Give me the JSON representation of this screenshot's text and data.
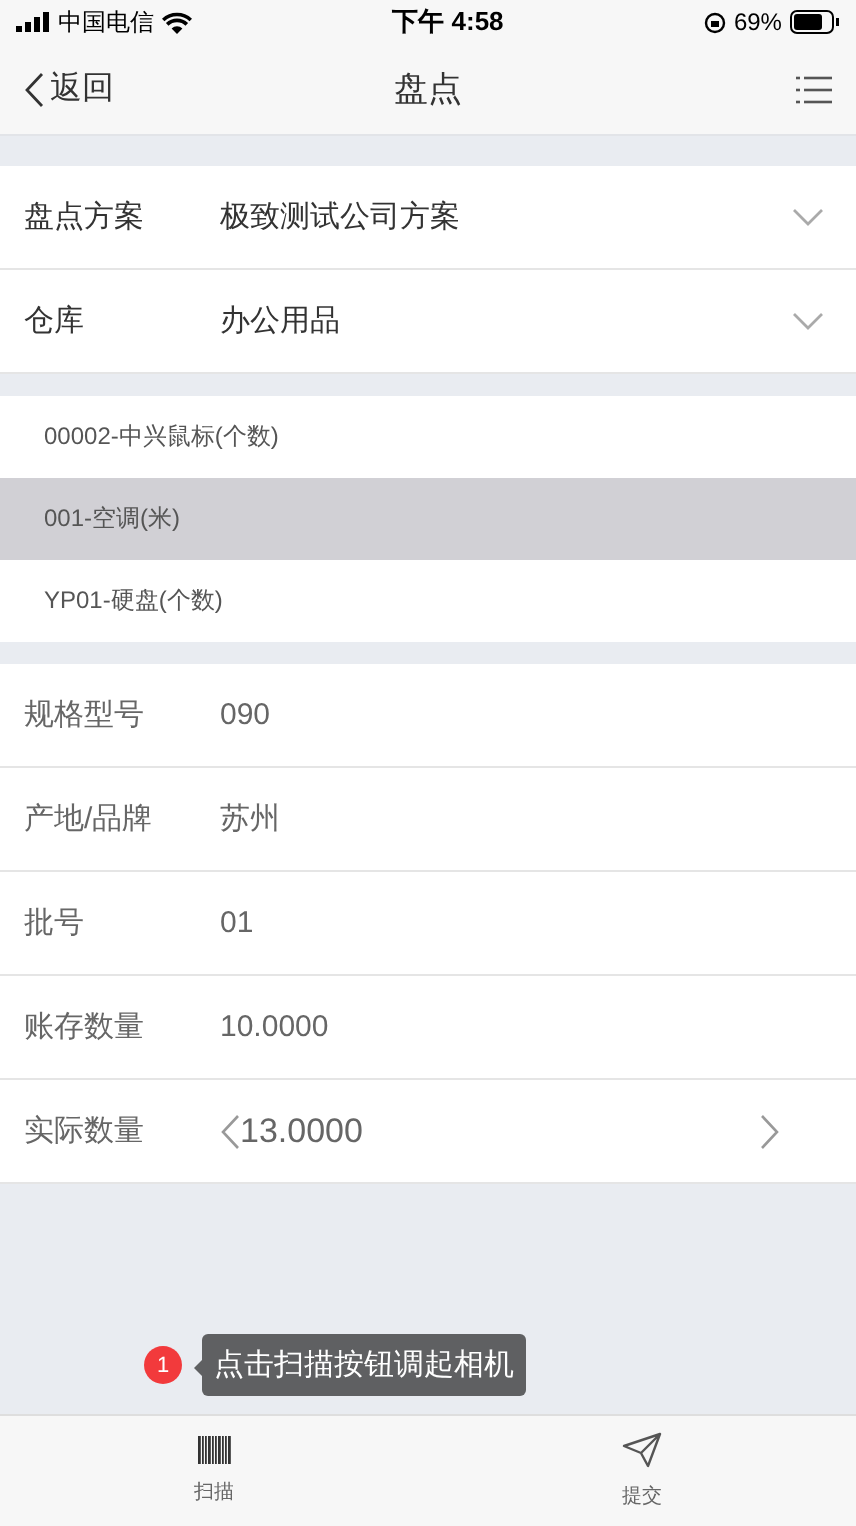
{
  "status_bar": {
    "carrier": "中国电信",
    "time": "下午 4:58",
    "battery": "69%"
  },
  "nav": {
    "back": "返回",
    "title": "盘点"
  },
  "selects": [
    {
      "label": "盘点方案",
      "value": "极致测试公司方案"
    },
    {
      "label": "仓库",
      "value": "办公用品"
    }
  ],
  "items": [
    {
      "text": "00002-中兴鼠标(个数)",
      "selected": false
    },
    {
      "text": "001-空调(米)",
      "selected": true
    },
    {
      "text": "YP01-硬盘(个数)",
      "selected": false
    }
  ],
  "details": [
    {
      "kind": "text",
      "label": "规格型号",
      "value": "090"
    },
    {
      "kind": "text",
      "label": "产地/品牌",
      "value": "苏州"
    },
    {
      "kind": "text",
      "label": "批号",
      "value": "01"
    },
    {
      "kind": "text",
      "label": "账存数量",
      "value": "10.0000"
    },
    {
      "kind": "stepper",
      "label": "实际数量",
      "value": "13.0000"
    }
  ],
  "hint": {
    "badge": "1",
    "text": "点击扫描按钮调起相机"
  },
  "tabs": [
    {
      "kind": "scan",
      "label": "扫描"
    },
    {
      "kind": "submit",
      "label": "提交"
    }
  ]
}
